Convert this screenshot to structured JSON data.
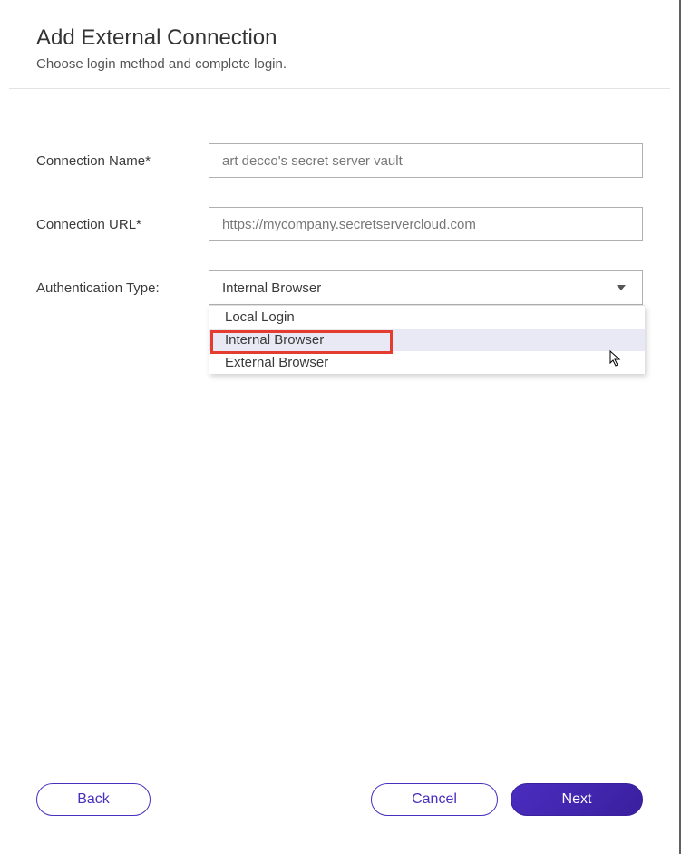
{
  "header": {
    "title": "Add External Connection",
    "subtitle": "Choose login method and complete login."
  },
  "form": {
    "connection_name": {
      "label": "Connection Name*",
      "value": "art decco's secret server vault"
    },
    "connection_url": {
      "label": "Connection URL*",
      "value": "https://mycompany.secretservercloud.com"
    },
    "auth_type": {
      "label": "Authentication Type:",
      "selected": "Internal Browser",
      "options": [
        "Local Login",
        "Internal Browser",
        "External Browser"
      ]
    }
  },
  "buttons": {
    "back": "Back",
    "cancel": "Cancel",
    "next": "Next"
  }
}
